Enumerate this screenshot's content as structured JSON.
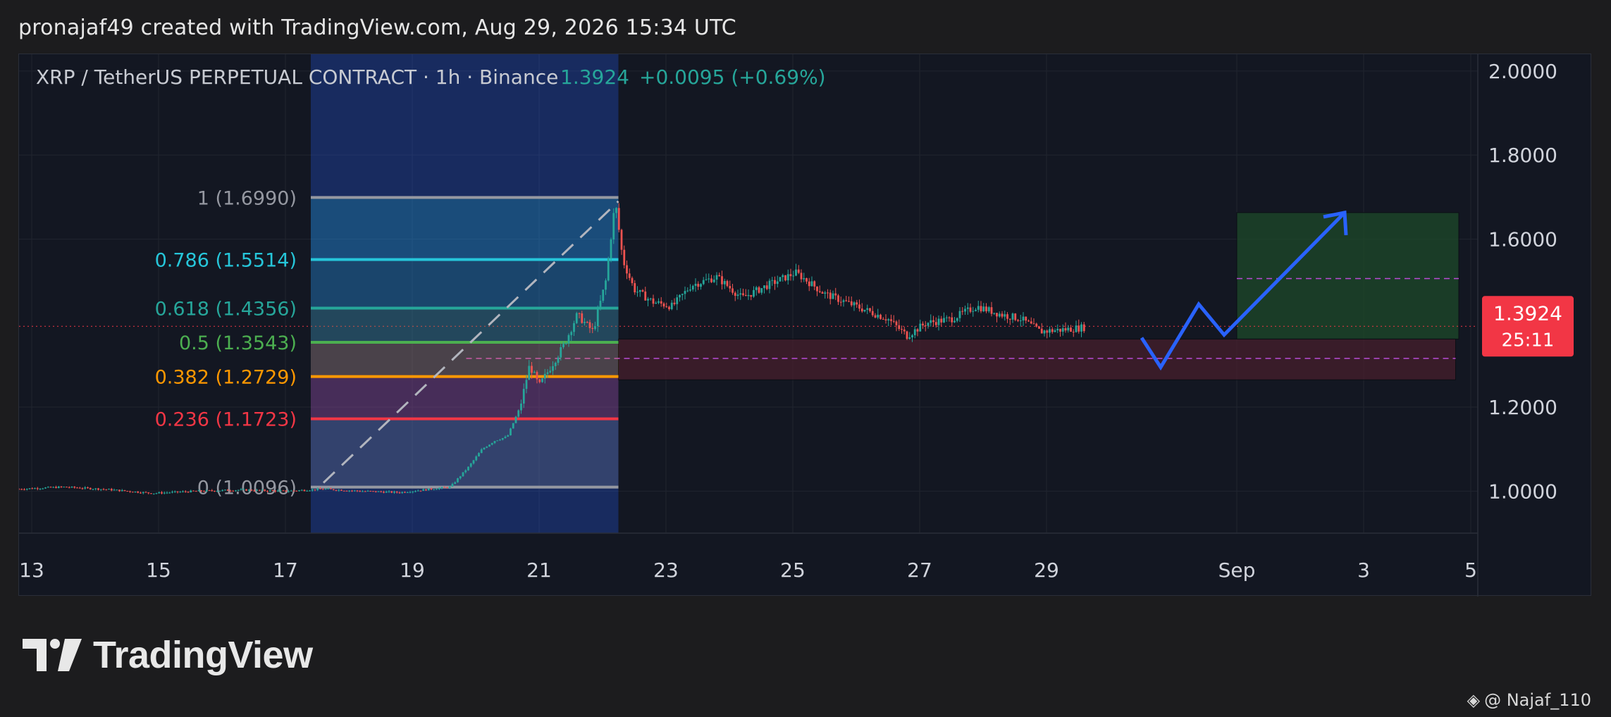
{
  "header": {
    "attribution": "pronajaf49 created with TradingView.com, Aug 29, 2026 15:34 UTC"
  },
  "legend": {
    "symbol": "XRP / TetherUS PERPETUAL CONTRACT · 1h · Binance",
    "price": "1.3924",
    "change": "+0.0095 (+0.69%)"
  },
  "price_label": {
    "price": "1.3924",
    "countdown": "25:11",
    "color": "#f23645"
  },
  "logo": {
    "text": "TradingView"
  },
  "watermark": {
    "text": "@ Najaf_110"
  },
  "chart_data": {
    "type": "candlestick",
    "x_tick_labels": [
      "13",
      "15",
      "17",
      "19",
      "21",
      "23",
      "25",
      "27",
      "29",
      "Sep",
      "3",
      "5"
    ],
    "y_tick_labels": [
      "2.0000",
      "1.8000",
      "1.6000",
      "1.2000",
      "1.0000"
    ],
    "y_ticks": [
      2.0,
      1.8,
      1.6,
      1.2,
      1.0
    ],
    "ylim": [
      0.9,
      2.04
    ],
    "x_range_days": [
      12.8,
      35.8
    ],
    "current_price": 1.3924,
    "fibonacci": {
      "start_day": 17.4,
      "end_day": 22.25,
      "levels": [
        {
          "label": "1 (1.6990)",
          "ratio": 1,
          "price": 1.699,
          "color": "#9598a1"
        },
        {
          "label": "0.786 (1.5514)",
          "ratio": 0.786,
          "price": 1.5514,
          "color": "#26c6da"
        },
        {
          "label": "0.618 (1.4356)",
          "ratio": 0.618,
          "price": 1.4356,
          "color": "#26a69a"
        },
        {
          "label": "0.5 (1.3543)",
          "ratio": 0.5,
          "price": 1.3543,
          "color": "#4caf50"
        },
        {
          "label": "0.382 (1.2729)",
          "ratio": 0.382,
          "price": 1.2729,
          "color": "#ff9800"
        },
        {
          "label": "0.236 (1.1723)",
          "ratio": 0.236,
          "price": 1.1723,
          "color": "#f23645"
        },
        {
          "label": "0 (1.0096)",
          "ratio": 0,
          "price": 1.0096,
          "color": "#9598a1"
        }
      ]
    },
    "highlight_range": {
      "start_day": 17.4,
      "end_day": 22.25,
      "color": "#2962ff"
    },
    "long_position": {
      "start_day": 32.0,
      "end_day": 35.5,
      "entry": 1.362,
      "target": 1.663,
      "stop": 1.265,
      "zone_top": 1.506,
      "zone_mid": 1.316
    },
    "projection_path": [
      {
        "day": 30.5,
        "price": 1.365
      },
      {
        "day": 30.8,
        "price": 1.295
      },
      {
        "day": 31.4,
        "price": 1.445
      },
      {
        "day": 31.8,
        "price": 1.372
      },
      {
        "day": 33.7,
        "price": 1.663
      }
    ],
    "price_series": [
      {
        "day": 12.8,
        "close": 1.005
      },
      {
        "day": 13.5,
        "close": 1.01
      },
      {
        "day": 14.2,
        "close": 1.004
      },
      {
        "day": 14.9,
        "close": 0.995
      },
      {
        "day": 15.6,
        "close": 1.0
      },
      {
        "day": 16.3,
        "close": 1.003
      },
      {
        "day": 17.0,
        "close": 1.0
      },
      {
        "day": 17.6,
        "close": 1.005
      },
      {
        "day": 18.2,
        "close": 1.0
      },
      {
        "day": 18.8,
        "close": 0.997
      },
      {
        "day": 19.3,
        "close": 1.005
      },
      {
        "day": 19.6,
        "close": 1.01
      },
      {
        "day": 19.9,
        "close": 1.06
      },
      {
        "day": 20.1,
        "close": 1.1
      },
      {
        "day": 20.3,
        "close": 1.12
      },
      {
        "day": 20.5,
        "close": 1.13
      },
      {
        "day": 20.7,
        "close": 1.2
      },
      {
        "day": 20.85,
        "close": 1.3
      },
      {
        "day": 21.0,
        "close": 1.25
      },
      {
        "day": 21.2,
        "close": 1.3
      },
      {
        "day": 21.4,
        "close": 1.35
      },
      {
        "day": 21.6,
        "close": 1.42
      },
      {
        "day": 21.85,
        "close": 1.38
      },
      {
        "day": 22.05,
        "close": 1.5
      },
      {
        "day": 22.2,
        "close": 1.69
      },
      {
        "day": 22.32,
        "close": 1.55
      },
      {
        "day": 22.5,
        "close": 1.48
      },
      {
        "day": 22.8,
        "close": 1.45
      },
      {
        "day": 23.1,
        "close": 1.44
      },
      {
        "day": 23.4,
        "close": 1.49
      },
      {
        "day": 23.8,
        "close": 1.51
      },
      {
        "day": 24.2,
        "close": 1.46
      },
      {
        "day": 24.6,
        "close": 1.49
      },
      {
        "day": 25.05,
        "close": 1.52
      },
      {
        "day": 25.5,
        "close": 1.47
      },
      {
        "day": 26.0,
        "close": 1.44
      },
      {
        "day": 26.5,
        "close": 1.41
      },
      {
        "day": 26.8,
        "close": 1.37
      },
      {
        "day": 27.1,
        "close": 1.4
      },
      {
        "day": 27.5,
        "close": 1.41
      },
      {
        "day": 27.9,
        "close": 1.44
      },
      {
        "day": 28.3,
        "close": 1.42
      },
      {
        "day": 28.6,
        "close": 1.41
      },
      {
        "day": 28.9,
        "close": 1.38
      },
      {
        "day": 29.3,
        "close": 1.385
      },
      {
        "day": 29.6,
        "close": 1.39
      }
    ]
  }
}
